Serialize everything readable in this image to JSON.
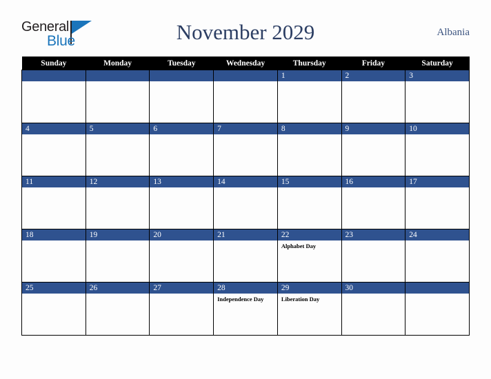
{
  "brand": {
    "name_part1": "General",
    "name_part2": "Blue",
    "colors": {
      "dark": "#231f20",
      "blue": "#1b75bb"
    }
  },
  "header": {
    "title": "November 2029",
    "country": "Albania",
    "title_color": "#2c3e63",
    "country_color": "#3c5480"
  },
  "calendar": {
    "accent_color": "#2f528f",
    "header_bg": "#000000",
    "weekdays": [
      "Sunday",
      "Monday",
      "Tuesday",
      "Wednesday",
      "Thursday",
      "Friday",
      "Saturday"
    ],
    "weeks": [
      [
        {
          "day": "",
          "events": []
        },
        {
          "day": "",
          "events": []
        },
        {
          "day": "",
          "events": []
        },
        {
          "day": "",
          "events": []
        },
        {
          "day": "1",
          "events": []
        },
        {
          "day": "2",
          "events": []
        },
        {
          "day": "3",
          "events": []
        }
      ],
      [
        {
          "day": "4",
          "events": []
        },
        {
          "day": "5",
          "events": []
        },
        {
          "day": "6",
          "events": []
        },
        {
          "day": "7",
          "events": []
        },
        {
          "day": "8",
          "events": []
        },
        {
          "day": "9",
          "events": []
        },
        {
          "day": "10",
          "events": []
        }
      ],
      [
        {
          "day": "11",
          "events": []
        },
        {
          "day": "12",
          "events": []
        },
        {
          "day": "13",
          "events": []
        },
        {
          "day": "14",
          "events": []
        },
        {
          "day": "15",
          "events": []
        },
        {
          "day": "16",
          "events": []
        },
        {
          "day": "17",
          "events": []
        }
      ],
      [
        {
          "day": "18",
          "events": []
        },
        {
          "day": "19",
          "events": []
        },
        {
          "day": "20",
          "events": []
        },
        {
          "day": "21",
          "events": []
        },
        {
          "day": "22",
          "events": [
            "Alphabet Day"
          ]
        },
        {
          "day": "23",
          "events": []
        },
        {
          "day": "24",
          "events": []
        }
      ],
      [
        {
          "day": "25",
          "events": []
        },
        {
          "day": "26",
          "events": []
        },
        {
          "day": "27",
          "events": []
        },
        {
          "day": "28",
          "events": [
            "Independence Day"
          ]
        },
        {
          "day": "29",
          "events": [
            "Liberation Day"
          ]
        },
        {
          "day": "30",
          "events": []
        },
        {
          "day": "",
          "events": []
        }
      ]
    ]
  }
}
